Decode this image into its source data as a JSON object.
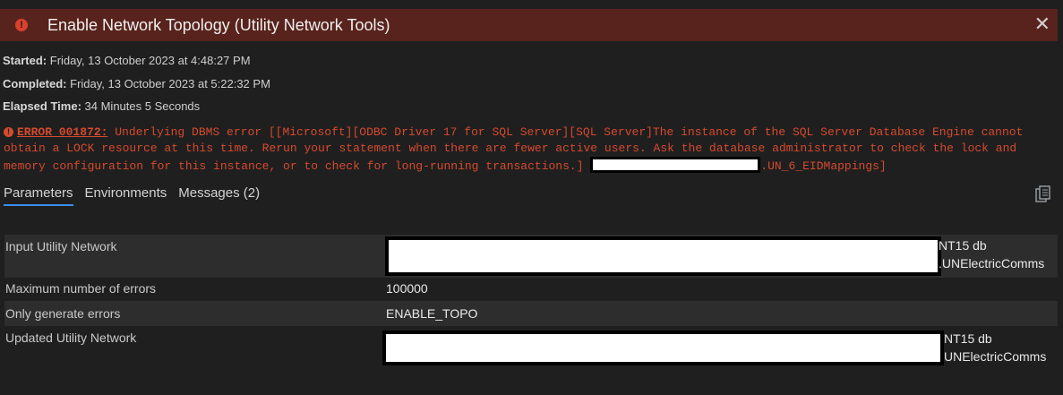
{
  "header": {
    "title": "Enable Network Topology (Utility Network Tools)",
    "close_label": "✕"
  },
  "meta": {
    "started_label": "Started:",
    "started_value": "Friday, 13 October 2023 at 4:48:27 PM",
    "completed_label": "Completed:",
    "completed_value": "Friday, 13 October 2023 at 5:22:32 PM",
    "elapsed_label": "Elapsed Time:",
    "elapsed_value": "34 Minutes 5 Seconds"
  },
  "error": {
    "code": "ERROR 001872:",
    "message": " Underlying DBMS error [[Microsoft][ODBC Driver 17 for SQL Server][SQL Server]The instance of the SQL Server Database Engine cannot obtain a LOCK resource at this time. Rerun your statement when there are fewer active users. Ask the database administrator to check the lock and memory configuration for this instance, or to check for long-running transactions.] ",
    "tail": ".UN_6_EIDMappings]",
    "color": "#d54a2f"
  },
  "tabs": [
    {
      "label": "Parameters",
      "active": true
    },
    {
      "label": "Environments",
      "active": false
    },
    {
      "label": "Messages (2)",
      "active": false
    }
  ],
  "params": [
    {
      "label": "Input Utility Network",
      "value_line1": "NT15 db",
      "value_line2": ".UNElectricComms"
    },
    {
      "label": "Maximum number of errors",
      "value": "100000"
    },
    {
      "label": "Only generate errors",
      "value": "ENABLE_TOPO"
    },
    {
      "label": "Updated Utility Network",
      "value_line1": "NT15 db",
      "value_line2": "UNElectricComms"
    }
  ]
}
